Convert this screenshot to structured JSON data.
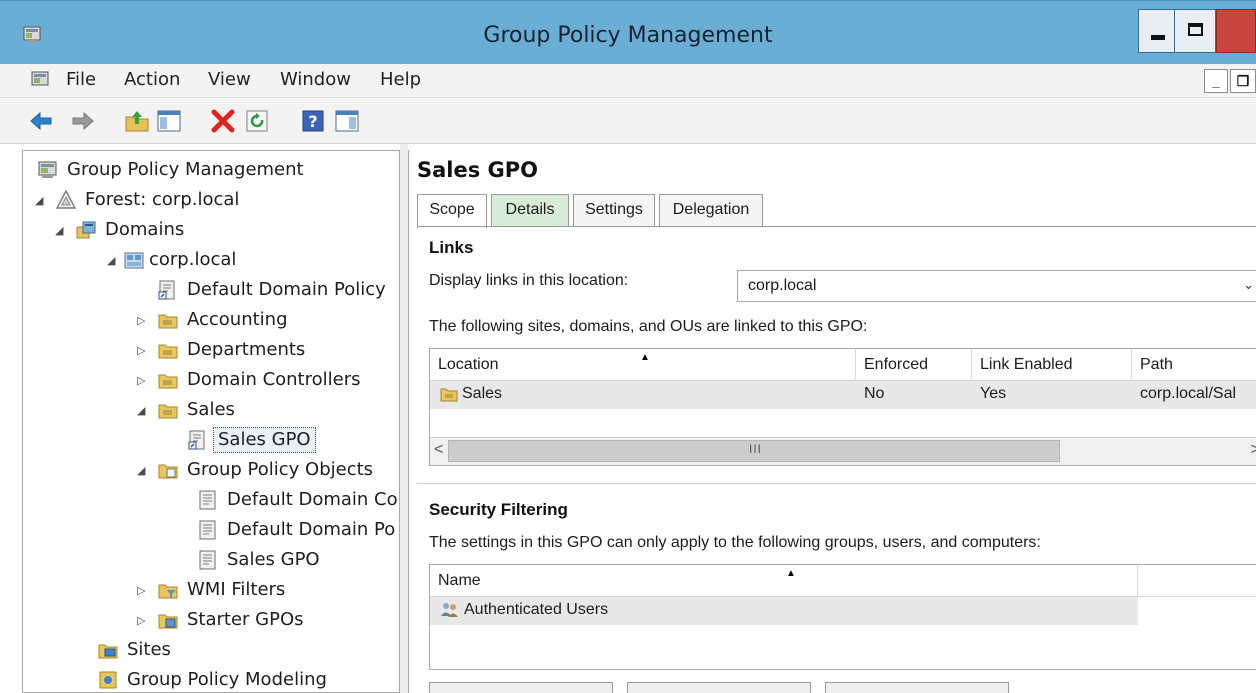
{
  "window": {
    "title": "Group Policy Management",
    "icon": "gpmc-console-icon"
  },
  "menu": {
    "items": [
      "File",
      "Action",
      "View",
      "Window",
      "Help"
    ]
  },
  "toolbar": {
    "buttons": [
      "back-icon",
      "forward-icon",
      "up-folder-icon",
      "show-hide-tree-icon",
      "delete-icon",
      "refresh-icon",
      "help-icon",
      "action-pane-icon"
    ]
  },
  "tree": {
    "root": "Group Policy Management",
    "forest": "Forest: corp.local",
    "domains": "Domains",
    "domain": "corp.local",
    "default_domain_policy": "Default Domain Policy",
    "accounting": "Accounting",
    "departments": "Departments",
    "domain_controllers": "Domain Controllers",
    "sales": "Sales",
    "sales_gpo_link": "Sales GPO",
    "gpo_container": "Group Policy Objects",
    "gpo_1": "Default Domain Co",
    "gpo_2": "Default Domain Po",
    "gpo_3": "Sales GPO",
    "wmi_filters": "WMI Filters",
    "starter_gpos": "Starter GPOs",
    "sites": "Sites",
    "modeling": "Group Policy Modeling"
  },
  "details": {
    "title": "Sales GPO",
    "tabs": [
      "Scope",
      "Details",
      "Settings",
      "Delegation"
    ],
    "active_tab": "Scope",
    "links": {
      "heading": "Links",
      "display_label": "Display links in this location:",
      "location_value": "corp.local",
      "description": "The following sites, domains, and OUs are linked to this GPO:",
      "columns": [
        "Location",
        "Enforced",
        "Link Enabled",
        "Path"
      ],
      "rows": [
        {
          "location": "Sales",
          "enforced": "No",
          "link_enabled": "Yes",
          "path": "corp.local/Sal"
        }
      ],
      "scroll_grip": "III"
    },
    "security": {
      "heading": "Security Filtering",
      "description": "The settings in this GPO can only apply to the following groups, users, and computers:",
      "columns": [
        "Name"
      ],
      "rows": [
        {
          "name": "Authenticated Users"
        }
      ]
    }
  },
  "colors": {
    "titlebar": "#6aaed6",
    "close_button": "#c7463f",
    "hover_tab": "#d9ecd9"
  }
}
